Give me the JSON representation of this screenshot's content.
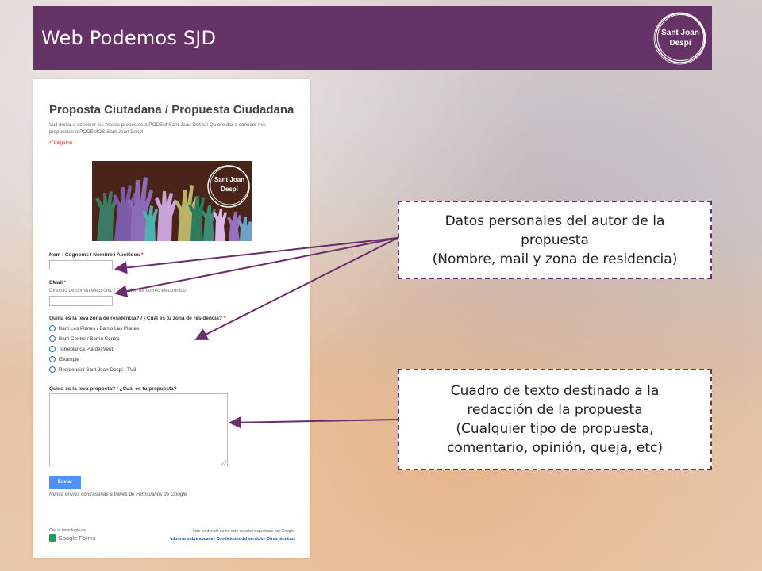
{
  "header": {
    "title": "Web Podemos SJD",
    "logo_line1": "Sant Joan",
    "logo_line2": "Despí",
    "background": "#663366"
  },
  "form": {
    "title": "Proposta Ciutadana / Propuesta Ciudadana",
    "description": "Vull donar a conèixer les meves propostes a PODEM Sant Joan Despí / Quiero dar a conocer mis propuestas a PODEMOS Sant Joan Despí",
    "required_note": "*Obligatori",
    "banner": {
      "line1": "Sant Joan",
      "line2": "Despí"
    },
    "name_label": "Nom i Cognoms / Nombre i Apellidos",
    "email_label": "EMail",
    "email_help": "Direcció de correu electrònic / Dirección de correo electrónico",
    "zone_label": "Quina és la teva zona de residència? / ¿Cuál es tu zona de residencia?",
    "zone_options": [
      "Barri Les Planes / Barrio Las Planes",
      "Barri Centre / Barrio Centro",
      "Torreblanca Pla del Vent",
      "Eixample",
      "Residencial Sant Joan Despí / TV3"
    ],
    "proposal_label": "Quina és la teva proposta? / ¿Cuál es tu propuesta?",
    "submit_label": "Enviar",
    "warning": "Nunca envíes contraseñas a través de Formularios de Google.",
    "powered_by": "Con la tecnología de",
    "gforms_text": "Google Forms",
    "footer_note": "Este contenido no ha sido creado ni aprobado por Google.",
    "footer_links": "Informar sobre abusos - Condiciones del servicio - Otros términos"
  },
  "callouts": {
    "personal": {
      "line1": "Datos personales del autor de la",
      "line2": "propuesta",
      "line3": "(Nombre, mail y zona de residencia)"
    },
    "textbox": {
      "line1": "Cuadro de texto destinado a la",
      "line2": "redacción de la propuesta",
      "line3": "(Cualquier tipo de propuesta,",
      "line4": "comentario, opinión, queja, etc)"
    }
  },
  "colors": {
    "accent": "#663366",
    "arrow": "#6b2d6b",
    "submit": "#4d90fe"
  }
}
